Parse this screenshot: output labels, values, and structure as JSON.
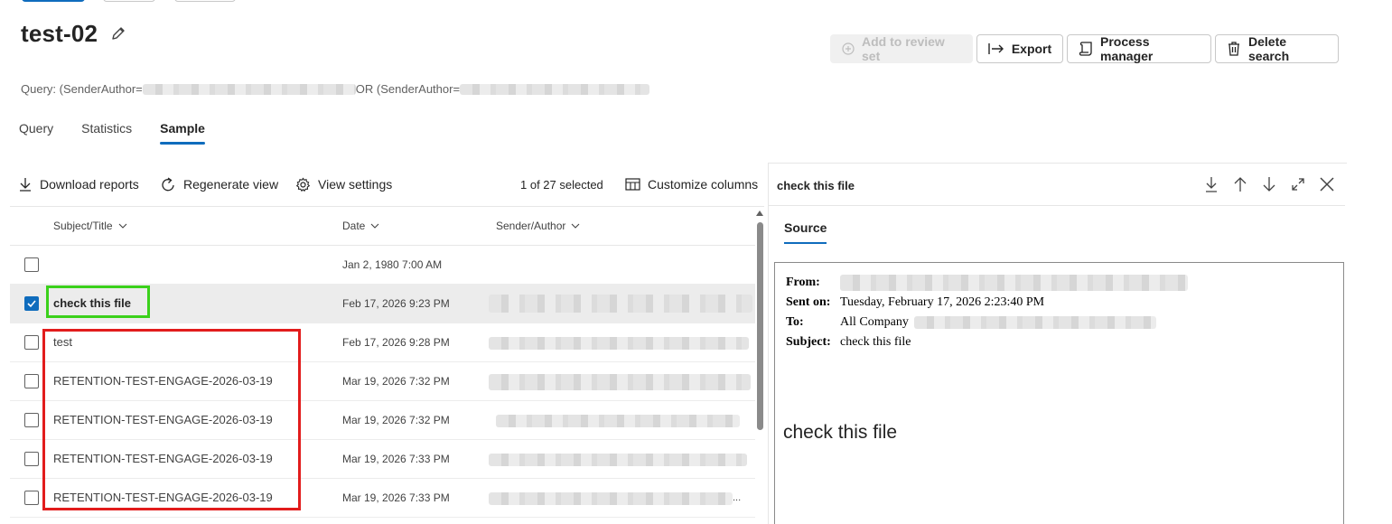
{
  "search": {
    "title": "test-02",
    "query_part1": "Query: (SenderAuthor=",
    "query_part2": "OR (SenderAuthor="
  },
  "commands": {
    "add_to_review_set": "Add to review set",
    "export": "Export",
    "process_manager": "Process manager",
    "delete_search": "Delete search"
  },
  "tabs": [
    {
      "label": "Query"
    },
    {
      "label": "Statistics"
    },
    {
      "label": "Sample"
    }
  ],
  "toolbar": {
    "download_reports": "Download reports",
    "regenerate_view": "Regenerate view",
    "view_settings": "View settings",
    "selection_count": "1 of 27 selected",
    "customize_columns": "Customize columns"
  },
  "grid": {
    "headers": {
      "subject": "Subject/Title",
      "date": "Date",
      "sender": "Sender/Author"
    },
    "rows": [
      {
        "subject": "",
        "date": "Jan 2, 1980 7:00 AM",
        "checked": false
      },
      {
        "subject": "check this file",
        "date": "Feb 17, 2026 9:23 PM",
        "checked": true
      },
      {
        "subject": "test",
        "date": "Feb 17, 2026 9:28 PM",
        "checked": false
      },
      {
        "subject": "RETENTION-TEST-ENGAGE-2026-03-19",
        "date": "Mar 19, 2026 7:32 PM",
        "checked": false
      },
      {
        "subject": "RETENTION-TEST-ENGAGE-2026-03-19",
        "date": "Mar 19, 2026 7:32 PM",
        "checked": false
      },
      {
        "subject": "RETENTION-TEST-ENGAGE-2026-03-19",
        "date": "Mar 19, 2026 7:33 PM",
        "checked": false
      },
      {
        "subject": "RETENTION-TEST-ENGAGE-2026-03-19",
        "date": "Mar 19, 2026 7:33 PM",
        "checked": false
      }
    ],
    "sender_truncated": "..."
  },
  "preview": {
    "title": "check this file",
    "tab": "Source",
    "from_label": "From:",
    "sent_label": "Sent on:",
    "sent_value": "Tuesday, February 17, 2026 2:23:40 PM",
    "to_label": "To:",
    "to_value": "All Company",
    "subject_label": "Subject:",
    "subject_value": "check this file",
    "body": "check this file"
  },
  "colors": {
    "accent": "#0f6cbd",
    "highlight_green": "#3bd11b",
    "highlight_red": "#e21c1c"
  }
}
